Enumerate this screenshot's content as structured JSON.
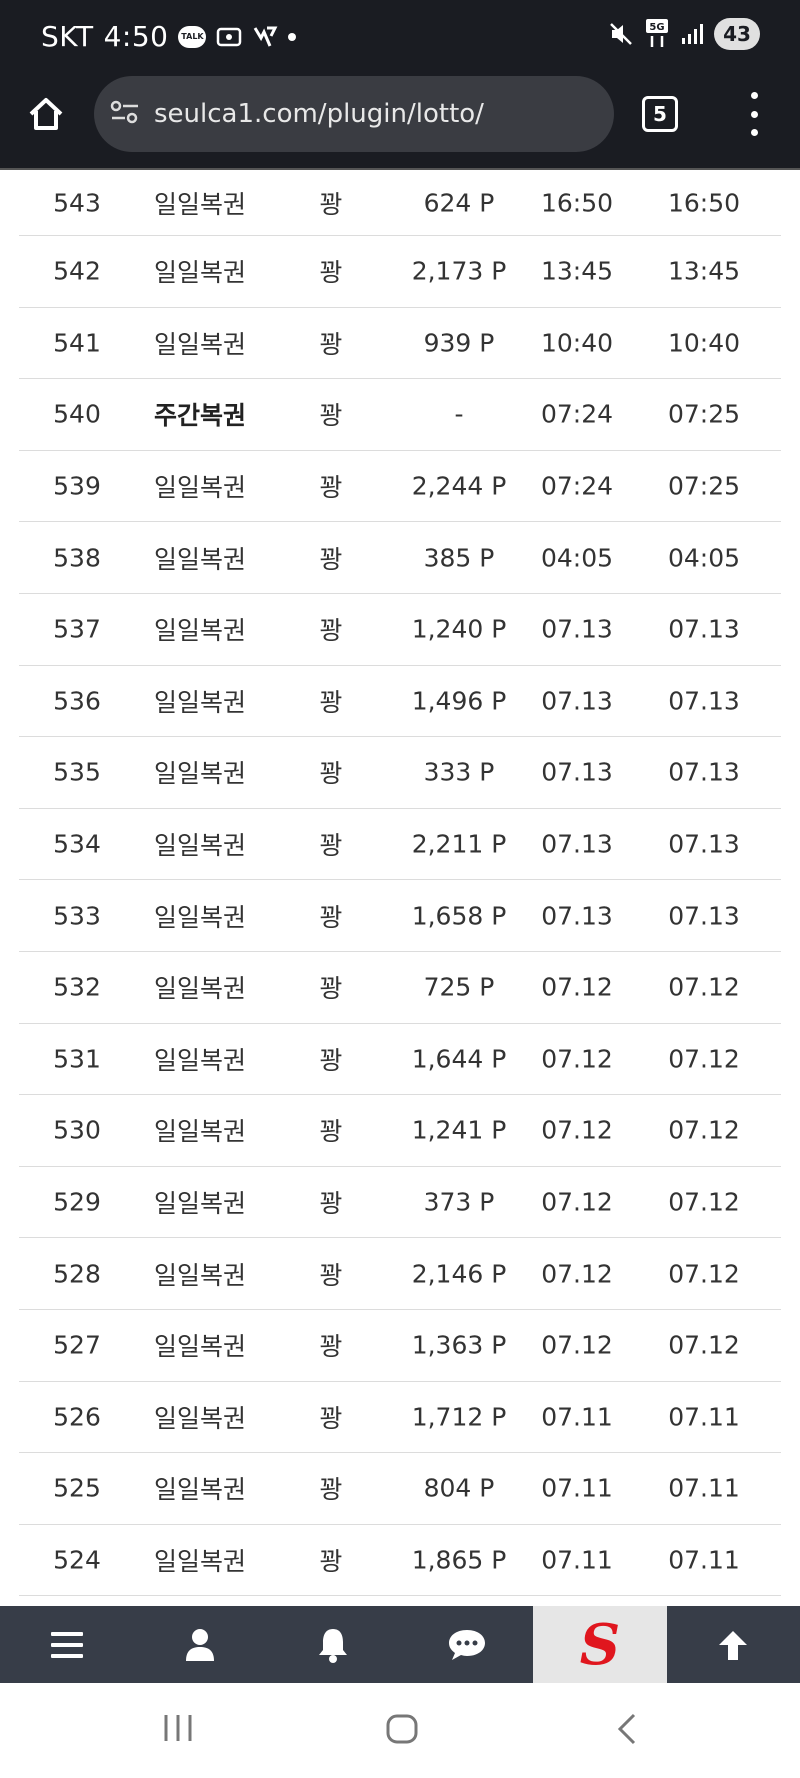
{
  "status_bar": {
    "carrier": "SKT",
    "time": "4:50",
    "talk_label": "TALK",
    "network": "5G",
    "battery": "43"
  },
  "browser": {
    "url": "seulca1.com/plugin/lotto/",
    "tab_count": "5"
  },
  "rows": [
    {
      "no": "543",
      "type": "일일복권",
      "result": "꽝",
      "point": "624 P",
      "time1": "16:50",
      "time2": "16:50"
    },
    {
      "no": "542",
      "type": "일일복권",
      "result": "꽝",
      "point": "2,173 P",
      "time1": "13:45",
      "time2": "13:45"
    },
    {
      "no": "541",
      "type": "일일복권",
      "result": "꽝",
      "point": "939 P",
      "time1": "10:40",
      "time2": "10:40"
    },
    {
      "no": "540",
      "type": "주간복권",
      "result": "꽝",
      "point": "-",
      "time1": "07:24",
      "time2": "07:25"
    },
    {
      "no": "539",
      "type": "일일복권",
      "result": "꽝",
      "point": "2,244 P",
      "time1": "07:24",
      "time2": "07:25"
    },
    {
      "no": "538",
      "type": "일일복권",
      "result": "꽝",
      "point": "385 P",
      "time1": "04:05",
      "time2": "04:05"
    },
    {
      "no": "537",
      "type": "일일복권",
      "result": "꽝",
      "point": "1,240 P",
      "time1": "07.13",
      "time2": "07.13"
    },
    {
      "no": "536",
      "type": "일일복권",
      "result": "꽝",
      "point": "1,496 P",
      "time1": "07.13",
      "time2": "07.13"
    },
    {
      "no": "535",
      "type": "일일복권",
      "result": "꽝",
      "point": "333 P",
      "time1": "07.13",
      "time2": "07.13"
    },
    {
      "no": "534",
      "type": "일일복권",
      "result": "꽝",
      "point": "2,211 P",
      "time1": "07.13",
      "time2": "07.13"
    },
    {
      "no": "533",
      "type": "일일복권",
      "result": "꽝",
      "point": "1,658 P",
      "time1": "07.13",
      "time2": "07.13"
    },
    {
      "no": "532",
      "type": "일일복권",
      "result": "꽝",
      "point": "725 P",
      "time1": "07.12",
      "time2": "07.12"
    },
    {
      "no": "531",
      "type": "일일복권",
      "result": "꽝",
      "point": "1,644 P",
      "time1": "07.12",
      "time2": "07.12"
    },
    {
      "no": "530",
      "type": "일일복권",
      "result": "꽝",
      "point": "1,241 P",
      "time1": "07.12",
      "time2": "07.12"
    },
    {
      "no": "529",
      "type": "일일복권",
      "result": "꽝",
      "point": "373 P",
      "time1": "07.12",
      "time2": "07.12"
    },
    {
      "no": "528",
      "type": "일일복권",
      "result": "꽝",
      "point": "2,146 P",
      "time1": "07.12",
      "time2": "07.12"
    },
    {
      "no": "527",
      "type": "일일복권",
      "result": "꽝",
      "point": "1,363 P",
      "time1": "07.12",
      "time2": "07.12"
    },
    {
      "no": "526",
      "type": "일일복권",
      "result": "꽝",
      "point": "1,712 P",
      "time1": "07.11",
      "time2": "07.11"
    },
    {
      "no": "525",
      "type": "일일복권",
      "result": "꽝",
      "point": "804 P",
      "time1": "07.11",
      "time2": "07.11"
    },
    {
      "no": "524",
      "type": "일일복권",
      "result": "꽝",
      "point": "1,865 P",
      "time1": "07.11",
      "time2": "07.11"
    }
  ],
  "bold_type": "주간복권",
  "site_nav": {
    "logo_letter": "S",
    "items": [
      "menu-icon",
      "user-icon",
      "bell-icon",
      "chat-icon",
      "site-logo",
      "arrow-up-icon"
    ]
  },
  "colors": {
    "status_bg": "#1a1c22",
    "url_box": "#3a3c42",
    "nav_bg": "#373d48",
    "logo_red": "#e0161e"
  }
}
